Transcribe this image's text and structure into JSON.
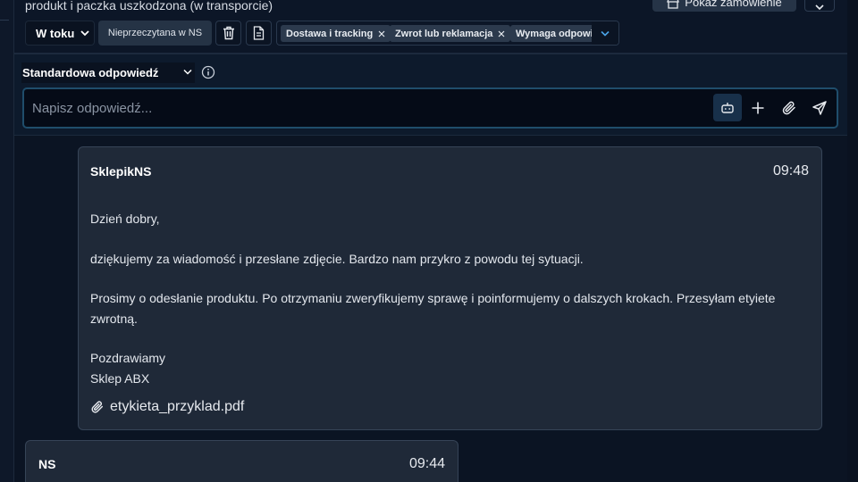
{
  "header": {
    "subject": "produkt i paczka uszkodzona (w transporcie)",
    "order_button_label": "Pokaż zamówienie",
    "status_value": "W toku",
    "unread_tag": "Nieprzeczytana w NS",
    "tags": [
      "Dostawa i tracking",
      "Zwrot lub reklamacja",
      "Wymaga odpowiedzi"
    ]
  },
  "reply": {
    "template_value": "Standardowa odpowiedź",
    "placeholder": "Napisz odpowiedź..."
  },
  "messages": [
    {
      "sender": "SklepikNS",
      "time": "09:48",
      "lines": [
        "Dzień dobry,",
        "dziękujemy za wiadomość i przesłane zdjęcie. Bardzo nam przykro z powodu tej sytuacji.",
        "Prosimy o odesłanie produktu. Po otrzymaniu zweryfikujemy sprawę i poinformujemy o dalszych krokach. Przesyłam etyiete",
        "zwrotną.",
        "Pozdrawiamy",
        "Sklep ABX"
      ],
      "attachment": "etykieta_przyklad.pdf"
    },
    {
      "sender": "NS",
      "time": "09:44"
    }
  ],
  "colors": {
    "background": "#0a1322",
    "card": "#1f2938",
    "accent_border": "#1f4d6b",
    "tag_bg": "#2c3a4d"
  }
}
